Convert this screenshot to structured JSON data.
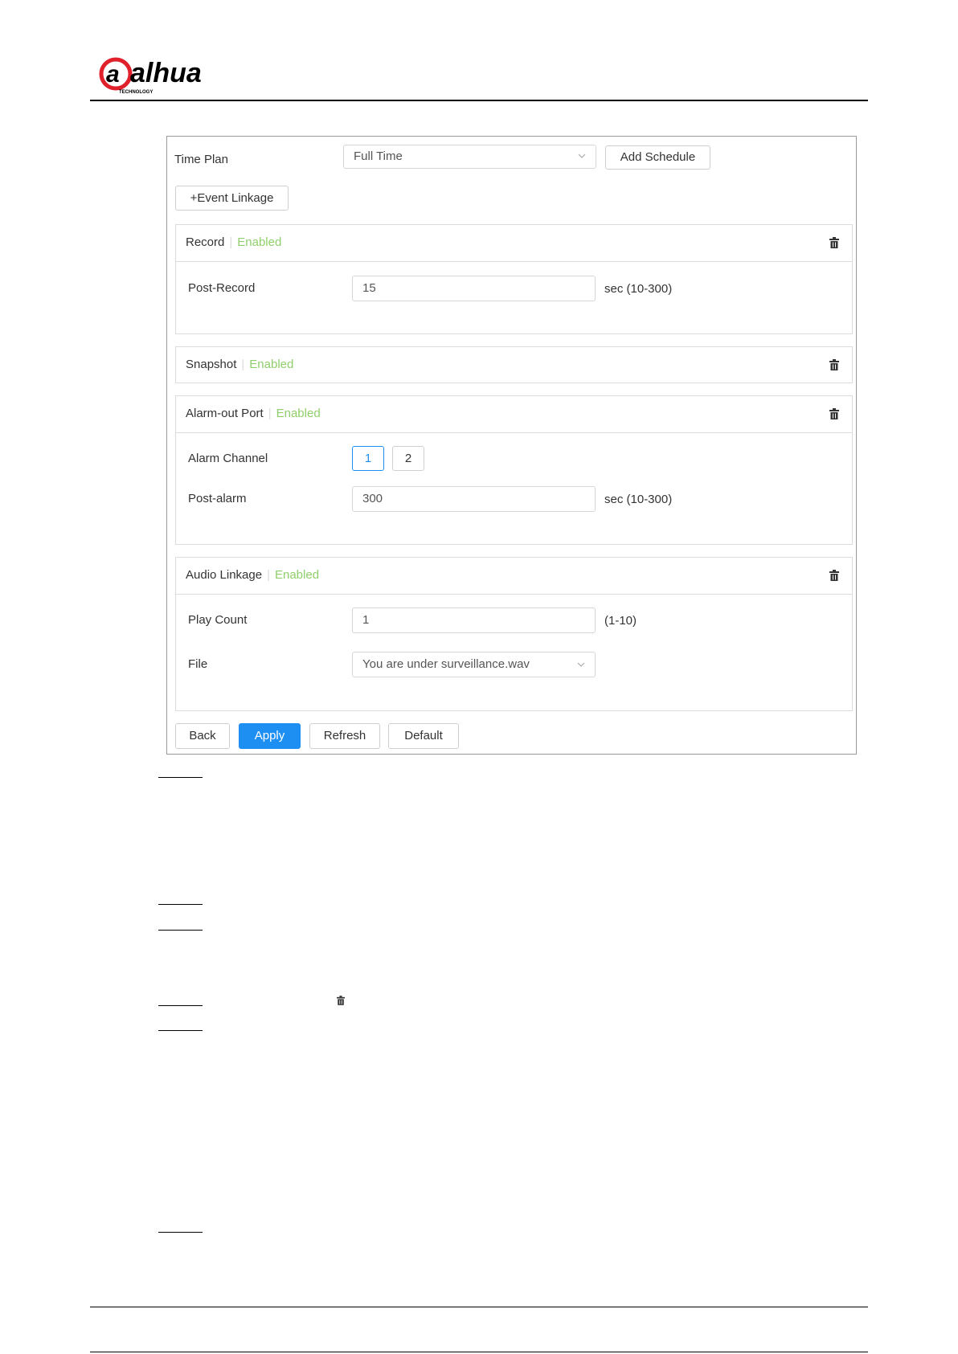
{
  "header": {
    "brand": "alhua",
    "brand_sub": "TECHNOLOGY"
  },
  "time_plan": {
    "label": "Time Plan",
    "value": "Full Time",
    "add_schedule_label": "Add Schedule"
  },
  "event_linkage_button": "+Event Linkage",
  "record": {
    "title": "Record",
    "status": "Enabled",
    "post_record_label": "Post-Record",
    "post_record_value": "15",
    "post_record_unit": "sec (10-300)"
  },
  "snapshot": {
    "title": "Snapshot",
    "status": "Enabled"
  },
  "alarm_out": {
    "title": "Alarm-out Port",
    "status": "Enabled",
    "channel_label": "Alarm Channel",
    "channels": [
      "1",
      "2"
    ],
    "post_alarm_label": "Post-alarm",
    "post_alarm_value": "300",
    "post_alarm_unit": "sec (10-300)"
  },
  "audio": {
    "title": "Audio Linkage",
    "status": "Enabled",
    "play_count_label": "Play Count",
    "play_count_value": "1",
    "play_count_unit": "(1-10)",
    "file_label": "File",
    "file_value": "You are under surveillance.wav"
  },
  "footer_buttons": {
    "back": "Back",
    "apply": "Apply",
    "refresh": "Refresh",
    "default": "Default"
  },
  "colors": {
    "accent": "#1e8ff2",
    "enabled": "#8fcf6a",
    "brand_red": "#e0202a"
  },
  "icons": [
    "trash-icon",
    "chevron-down-icon"
  ]
}
